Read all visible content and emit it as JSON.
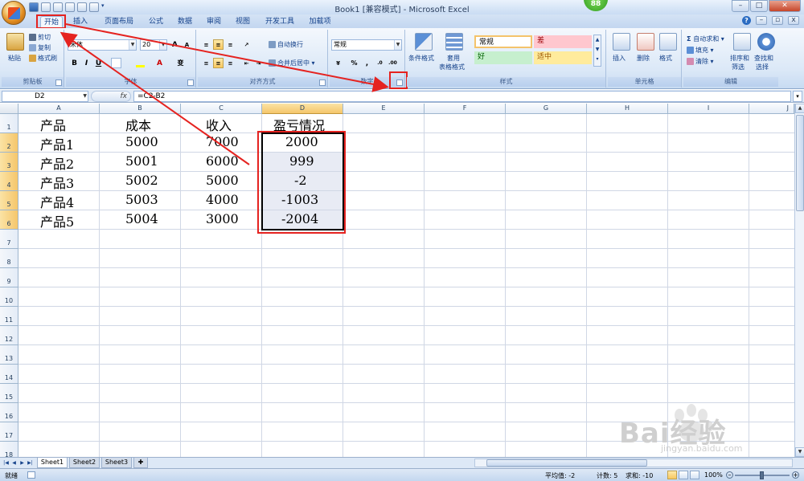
{
  "app": {
    "title": "Book1  [兼容模式] - Microsoft Excel",
    "badge": "88",
    "quick_access": [
      "save-icon",
      "undo-icon",
      "redo-icon",
      "new-icon",
      "print-icon",
      "preview-icon"
    ]
  },
  "window_controls": {
    "minimize": "–",
    "maximize": "□",
    "close": "✕"
  },
  "tabs": [
    "开始",
    "插入",
    "页面布局",
    "公式",
    "数据",
    "审阅",
    "视图",
    "开发工具",
    "加载项"
  ],
  "active_tab": "开始",
  "ribbon": {
    "clipboard": {
      "label": "剪贴板",
      "paste": "粘贴",
      "cut": "剪切",
      "copy": "复制",
      "format_painter": "格式刷"
    },
    "font": {
      "label": "字体",
      "font_name": "宋体",
      "font_size": "20",
      "bold": "B",
      "italic": "I",
      "underline": "U",
      "grow": "A",
      "shrink": "A",
      "phonetic": "变"
    },
    "alignment": {
      "label": "对齐方式",
      "wrap": "自动换行",
      "merge": "合并后居中"
    },
    "number": {
      "label": "数字",
      "format": "常规",
      "percent": "%",
      "comma": ","
    },
    "styles": {
      "label": "样式",
      "conditional": "条件格式",
      "table_format_1": "套用",
      "table_format_2": "表格格式",
      "cell_styles": [
        {
          "name": "常规",
          "bg": "#ffffff",
          "fg": "#000000"
        },
        {
          "name": "差",
          "bg": "#ffc7ce",
          "fg": "#9c0006"
        },
        {
          "name": "好",
          "bg": "#c6efce",
          "fg": "#006100"
        },
        {
          "name": "适中",
          "bg": "#ffeb9c",
          "fg": "#9c5700"
        }
      ]
    },
    "cells": {
      "label": "单元格",
      "insert": "插入",
      "delete": "删除",
      "format": "格式"
    },
    "editing": {
      "label": "编辑",
      "autosum": "自动求和",
      "fill": "填充",
      "clear": "清除",
      "sort_1": "排序和",
      "sort_2": "筛选",
      "find_1": "查找和",
      "find_2": "选择"
    }
  },
  "formula_bar": {
    "name_box": "D2",
    "fx": "fx",
    "formula": "=C2-B2"
  },
  "grid": {
    "columns": [
      "A",
      "B",
      "C",
      "D",
      "E",
      "F",
      "G",
      "H",
      "I",
      "J"
    ],
    "rows": [
      "1",
      "2",
      "3",
      "4",
      "5",
      "6",
      "7",
      "8",
      "9",
      "10",
      "11",
      "12",
      "13",
      "14",
      "15",
      "16",
      "17",
      "18"
    ],
    "table": [
      [
        "产品",
        "成本",
        "收入",
        "盈亏情况"
      ],
      [
        "产品1",
        "5000",
        "7000",
        "2000"
      ],
      [
        "产品2",
        "5001",
        "6000",
        "999"
      ],
      [
        "产品3",
        "5002",
        "5000",
        "-2"
      ],
      [
        "产品4",
        "5003",
        "4000",
        "-1003"
      ],
      [
        "产品5",
        "5004",
        "3000",
        "-2004"
      ]
    ]
  },
  "sheets": [
    "Sheet1",
    "Sheet2",
    "Sheet3"
  ],
  "active_sheet": "Sheet1",
  "status": {
    "mode": "就绪",
    "average": "平均值: -2",
    "count": "计数: 5",
    "sum": "求和: -10",
    "zoom": "100%"
  },
  "watermark": {
    "text": "Bai经验",
    "url": "jingyan.baidu.com"
  },
  "colors": {
    "accent": "#15428b",
    "annotation_red": "#e52320",
    "selection": "#f5c66b"
  }
}
